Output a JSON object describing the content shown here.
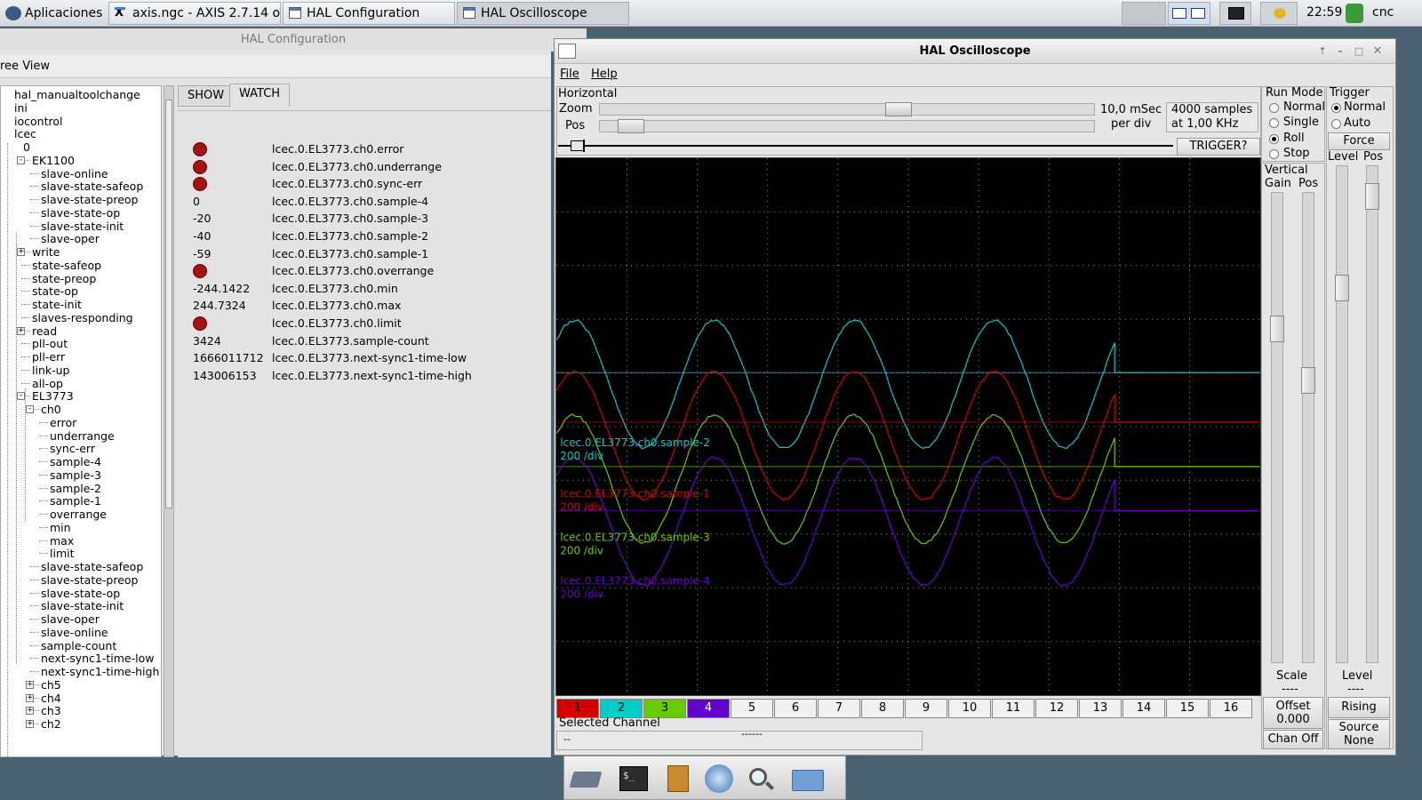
{
  "taskbar": {
    "apps_label": "Aplicaciones",
    "tasks": [
      {
        "label": "axis.ngc - AXIS 2.7.14 o..."
      },
      {
        "label": "HAL Configuration"
      },
      {
        "label": "HAL Oscilloscope"
      }
    ],
    "clock": "22:59",
    "user": "cnc"
  },
  "hal_config": {
    "title": "HAL Configuration",
    "tree_tab": "ree View",
    "watch_tabs": [
      "SHOW",
      "WATCH"
    ],
    "tree": [
      {
        "label": "hal_manualtoolchange",
        "indent": 0
      },
      {
        "label": "ini",
        "indent": 0
      },
      {
        "label": "iocontrol",
        "indent": 0
      },
      {
        "label": "lcec",
        "indent": 0
      },
      {
        "label": "0",
        "indent": 1
      },
      {
        "label": "EK1100",
        "indent": 2,
        "exp": "-"
      },
      {
        "label": "slave-online",
        "indent": 3
      },
      {
        "label": "slave-state-safeop",
        "indent": 3
      },
      {
        "label": "slave-state-preop",
        "indent": 3
      },
      {
        "label": "slave-state-op",
        "indent": 3
      },
      {
        "label": "slave-state-init",
        "indent": 3
      },
      {
        "label": "slave-oper",
        "indent": 3
      },
      {
        "label": "write",
        "indent": 2,
        "exp": "+"
      },
      {
        "label": "state-safeop",
        "indent": 2
      },
      {
        "label": "state-preop",
        "indent": 2
      },
      {
        "label": "state-op",
        "indent": 2
      },
      {
        "label": "state-init",
        "indent": 2
      },
      {
        "label": "slaves-responding",
        "indent": 2
      },
      {
        "label": "read",
        "indent": 2,
        "exp": "+"
      },
      {
        "label": "pll-out",
        "indent": 2
      },
      {
        "label": "pll-err",
        "indent": 2
      },
      {
        "label": "link-up",
        "indent": 2
      },
      {
        "label": "all-op",
        "indent": 2
      },
      {
        "label": "EL3773",
        "indent": 2,
        "exp": "-"
      },
      {
        "label": "ch0",
        "indent": 3,
        "exp": "-"
      },
      {
        "label": "error",
        "indent": 4
      },
      {
        "label": "underrange",
        "indent": 4
      },
      {
        "label": "sync-err",
        "indent": 4
      },
      {
        "label": "sample-4",
        "indent": 4
      },
      {
        "label": "sample-3",
        "indent": 4
      },
      {
        "label": "sample-2",
        "indent": 4
      },
      {
        "label": "sample-1",
        "indent": 4
      },
      {
        "label": "overrange",
        "indent": 4
      },
      {
        "label": "min",
        "indent": 4
      },
      {
        "label": "max",
        "indent": 4
      },
      {
        "label": "limit",
        "indent": 4
      },
      {
        "label": "slave-state-safeop",
        "indent": 3
      },
      {
        "label": "slave-state-preop",
        "indent": 3
      },
      {
        "label": "slave-state-op",
        "indent": 3
      },
      {
        "label": "slave-state-init",
        "indent": 3
      },
      {
        "label": "slave-oper",
        "indent": 3
      },
      {
        "label": "slave-online",
        "indent": 3
      },
      {
        "label": "sample-count",
        "indent": 3
      },
      {
        "label": "next-sync1-time-low",
        "indent": 3
      },
      {
        "label": "next-sync1-time-high",
        "indent": 3
      },
      {
        "label": "ch5",
        "indent": 3,
        "exp": "+"
      },
      {
        "label": "ch4",
        "indent": 3,
        "exp": "+"
      },
      {
        "label": "ch3",
        "indent": 3,
        "exp": "+"
      },
      {
        "label": "ch2",
        "indent": 3,
        "exp": "+"
      }
    ],
    "watch": [
      {
        "value": "",
        "led": true,
        "name": "lcec.0.EL3773.ch0.error"
      },
      {
        "value": "",
        "led": true,
        "name": "lcec.0.EL3773.ch0.underrange"
      },
      {
        "value": "",
        "led": true,
        "name": "lcec.0.EL3773.ch0.sync-err"
      },
      {
        "value": "0",
        "led": false,
        "name": "lcec.0.EL3773.ch0.sample-4"
      },
      {
        "value": "-20",
        "led": false,
        "name": "lcec.0.EL3773.ch0.sample-3"
      },
      {
        "value": "-40",
        "led": false,
        "name": "lcec.0.EL3773.ch0.sample-2"
      },
      {
        "value": "-59",
        "led": false,
        "name": "lcec.0.EL3773.ch0.sample-1"
      },
      {
        "value": "",
        "led": true,
        "name": "lcec.0.EL3773.ch0.overrange"
      },
      {
        "value": "-244.1422",
        "led": false,
        "name": "lcec.0.EL3773.ch0.min"
      },
      {
        "value": "244.7324",
        "led": false,
        "name": "lcec.0.EL3773.ch0.max"
      },
      {
        "value": "",
        "led": true,
        "name": "lcec.0.EL3773.ch0.limit"
      },
      {
        "value": "3424",
        "led": false,
        "name": "lcec.0.EL3773.sample-count"
      },
      {
        "value": "1666011712",
        "led": false,
        "name": "lcec.0.EL3773.next-sync1-time-low"
      },
      {
        "value": "143006153",
        "led": false,
        "name": "lcec.0.EL3773.next-sync1-time-high"
      }
    ]
  },
  "scope": {
    "title": "HAL Oscilloscope",
    "menu": [
      "File",
      "Help"
    ],
    "horizontal": {
      "label": "Horizontal",
      "zoom_label": "Zoom",
      "pos_label": "Pos",
      "time_per_div": "10,0 mSec",
      "per_div": "per div",
      "samples": "4000 samples",
      "rate": "at 1,00 KHz",
      "trigger_btn": "TRIGGER?",
      "zoom_fraction": 0.61,
      "pos_fraction": 0.04
    },
    "run_mode": {
      "label": "Run Mode",
      "options": [
        "Normal",
        "Single",
        "Roll",
        "Stop"
      ],
      "selected": "Roll"
    },
    "trigger": {
      "label": "Trigger",
      "options": [
        "Normal",
        "Auto"
      ],
      "selected": "Normal",
      "force": "Force",
      "level_label": "Level",
      "pos_label": "Pos",
      "level_value_label": "Level",
      "level_value": "----",
      "edge": "Rising",
      "source_label": "Source",
      "source": "None"
    },
    "vertical": {
      "label": "Vertical",
      "gain_label": "Gain",
      "pos_label": "Pos",
      "scale_label": "Scale",
      "scale_value": "----",
      "offset_label": "Offset",
      "offset_value": "0.000",
      "chan_off": "Chan Off"
    },
    "channel_buttons": [
      "1",
      "2",
      "3",
      "4",
      "5",
      "6",
      "7",
      "8",
      "9",
      "10",
      "11",
      "12",
      "13",
      "14",
      "15",
      "16"
    ],
    "channel_colors": [
      "#d40000",
      "#00cccc",
      "#66cc00",
      "#6600cc"
    ],
    "selected_channel_label": "Selected Channel",
    "selected_channel_value": "--",
    "selected_channel_dashes": "------",
    "trace_labels": [
      {
        "name": "lcec.0.EL3773.ch0.sample-2",
        "scale": "200 /div",
        "color": "#00cccc"
      },
      {
        "name": "lcec.0.EL3773.ch0.sample-1",
        "scale": "200 /div",
        "color": "#d40000"
      },
      {
        "name": "lcec.0.EL3773.ch0.sample-3",
        "scale": "200 /div",
        "color": "#66cc00"
      },
      {
        "name": "lcec.0.EL3773.ch0.sample-4",
        "scale": "200 /div",
        "color": "#6600cc"
      }
    ]
  },
  "colors": {
    "desktop": "#4a6272",
    "plot_bg": "#000000",
    "led_red": "#a51414"
  }
}
